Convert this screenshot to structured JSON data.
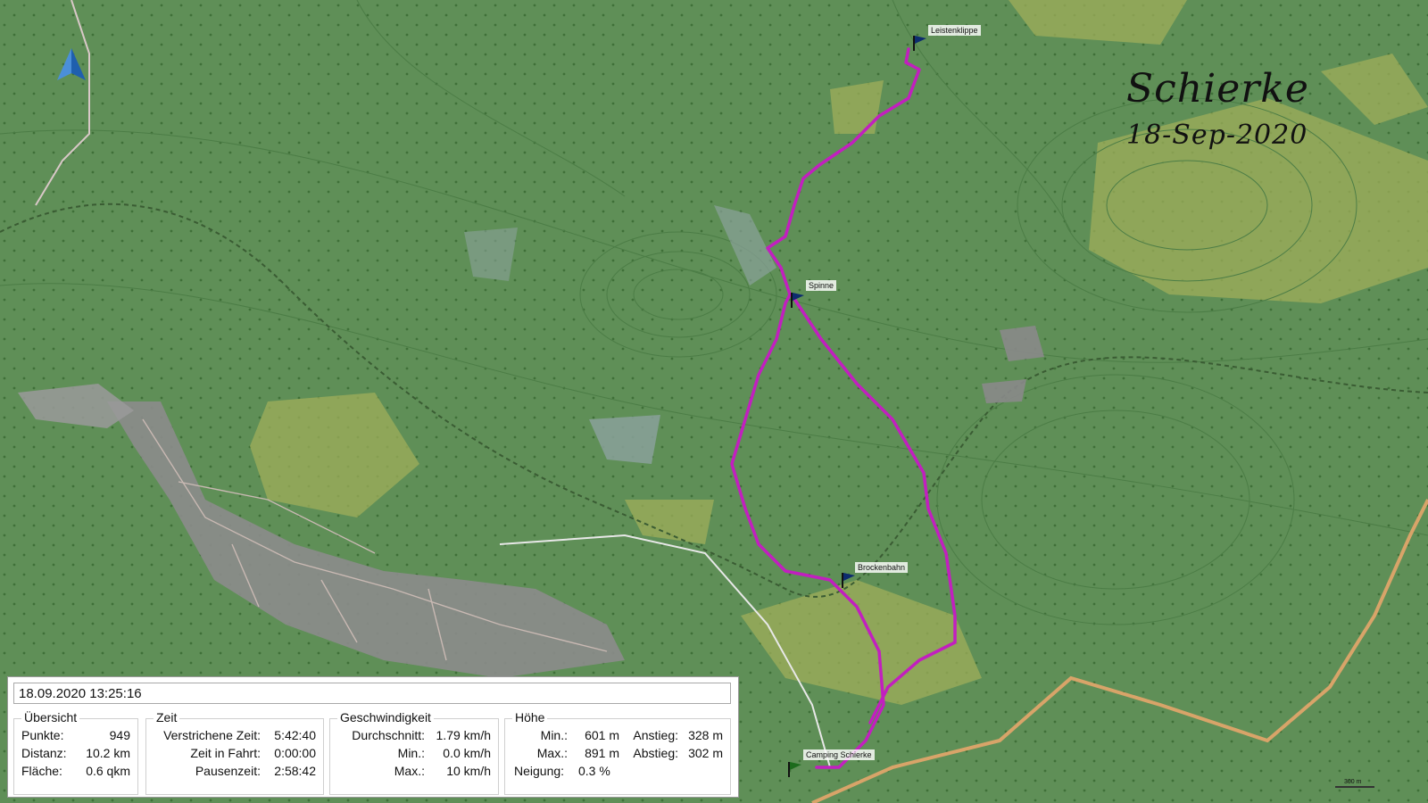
{
  "map": {
    "title": "Schierke",
    "date": "18-Sep-2020",
    "scale_label": "300 m",
    "colors": {
      "forest": "#5f8f57",
      "meadow": "#9fae5a",
      "track": "#c21fbf",
      "town": "#8c8c8c",
      "road": "#d8a469",
      "contour": "#4c7d46"
    },
    "icons": [
      "north-arrow-icon",
      "waypoint-flag-icon",
      "start-flag-icon"
    ],
    "waypoints": [
      {
        "label": "Leistenklippe"
      },
      {
        "label": "Spinne"
      },
      {
        "label": "Brockenbahn"
      },
      {
        "label": "Camping Schierke"
      }
    ]
  },
  "panel": {
    "timestamp": "18.09.2020 13:25:16",
    "overview": {
      "legend": "Übersicht",
      "points_label": "Punkte:",
      "points_value": "949",
      "distance_label": "Distanz:",
      "distance_value": "10.2 km",
      "area_label": "Fläche:",
      "area_value": "0.6 qkm"
    },
    "time": {
      "legend": "Zeit",
      "elapsed_label": "Verstrichene Zeit:",
      "elapsed_value": "5:42:40",
      "moving_label": "Zeit in Fahrt:",
      "moving_value": "0:00:00",
      "pause_label": "Pausenzeit:",
      "pause_value": "2:58:42"
    },
    "speed": {
      "legend": "Geschwindigkeit",
      "avg_label": "Durchschnitt:",
      "avg_value": "1.79 km/h",
      "min_label": "Min.:",
      "min_value": "0.0 km/h",
      "max_label": "Max.:",
      "max_value": "10 km/h"
    },
    "altitude": {
      "legend": "Höhe",
      "min_label": "Min.:",
      "min_value": "601 m",
      "max_label": "Max.:",
      "max_value": "891 m",
      "ascent_label": "Anstieg:",
      "ascent_value": "328 m",
      "descent_label": "Abstieg:",
      "descent_value": "302 m",
      "slope_label": "Neigung:",
      "slope_value": "0.3 %"
    }
  }
}
